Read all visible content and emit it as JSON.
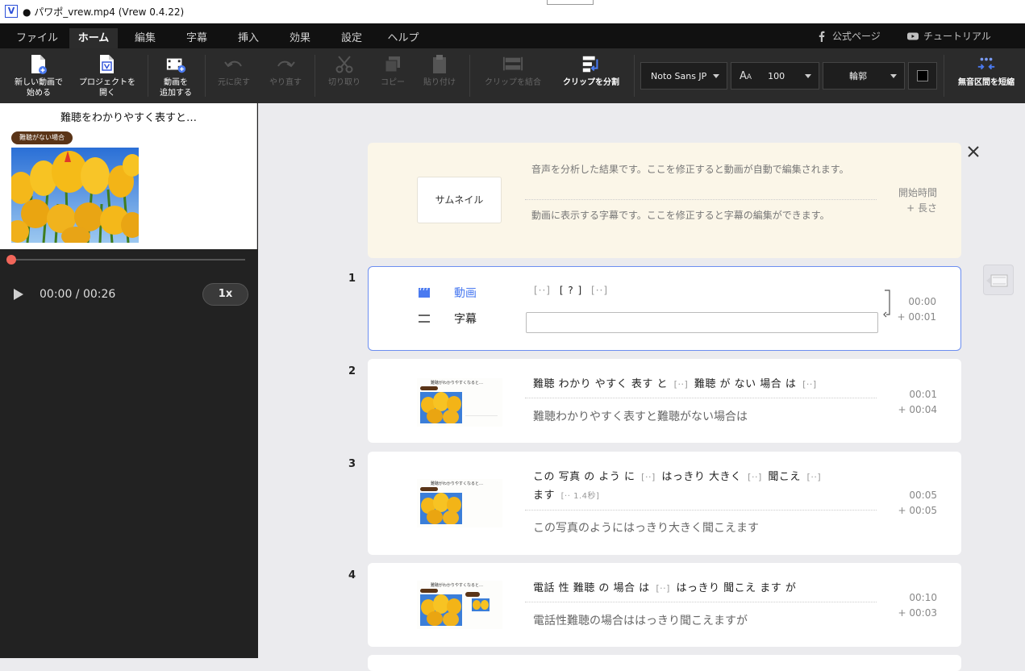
{
  "window": {
    "title": "● パワポ_vrew.mp4 (Vrew 0.4.22)",
    "app_icon_letter": "V"
  },
  "menu": {
    "items": [
      "ファイル",
      "ホーム",
      "編集",
      "字幕",
      "挿入",
      "効果",
      "設定",
      "ヘルプ"
    ],
    "active": "ホーム",
    "official_page": "公式ページ",
    "tutorial": "チュートリアル"
  },
  "toolbar": {
    "new_video": "新しい動画で\n始める",
    "open_project": "プロジェクトを\n開く",
    "add_video": "動画を\n追加する",
    "undo": "元に戻す",
    "redo": "やり直す",
    "cut": "切り取り",
    "copy": "コピー",
    "paste": "貼り付け",
    "merge_clips": "クリップを結合",
    "split_clip": "クリップを分割",
    "font": "Noto Sans JP",
    "font_size": "100",
    "outline": "輪郭",
    "shorten_silence": "無音区間を短縮",
    "accent_color": "#4a7af0"
  },
  "preview": {
    "title": "難聴をわかりやすく表すと…",
    "badge": "難聴がない場合",
    "timecode": "00:00 / 00:26",
    "speed": "1x",
    "progress": 0
  },
  "header": {
    "thumbnail_button": "サムネイル",
    "audio_hint": "音声を分析した結果です。ここを修正すると動画が自動で編集されます。",
    "caption_hint": "動画に表示する字幕です。ここを修正すると字幕の編集ができます。",
    "start_time_label": "開始時間",
    "length_label": "+ 長さ"
  },
  "clips": [
    {
      "num": "1",
      "video_label": "動画",
      "caption_label": "字幕",
      "gaps": [
        "[··]",
        "[ ? ]",
        "[··]"
      ],
      "start": "00:00",
      "length": "+ 00:01"
    },
    {
      "num": "2",
      "words": "難聴 わかり やすく 表す と",
      "words_b": "難聴 が ない 場合 は",
      "subtitle": "難聴わかりやすく表すと難聴がない場合は",
      "start": "00:01",
      "length": "+ 00:04"
    },
    {
      "num": "3",
      "words_a": "この 写真 の よう に",
      "words_b": "はっきり 大きく",
      "words_c": "聞こえ",
      "words_d": "ます",
      "gap_long": "[·· 1.4秒]",
      "subtitle": "この写真のようにはっきり大きく聞こえます",
      "start": "00:05",
      "length": "+ 00:05"
    },
    {
      "num": "4",
      "words_a": "電話 性 難聴 の 場合 は",
      "words_b": "はっきり 聞こえ ます が",
      "subtitle": "電話性難聴の場合ははっきり聞こえますが",
      "start": "00:10",
      "length": "+ 00:03"
    }
  ],
  "gap_short": "[··]",
  "thumb_mini_title": "難聴がわかりやすくなると…"
}
